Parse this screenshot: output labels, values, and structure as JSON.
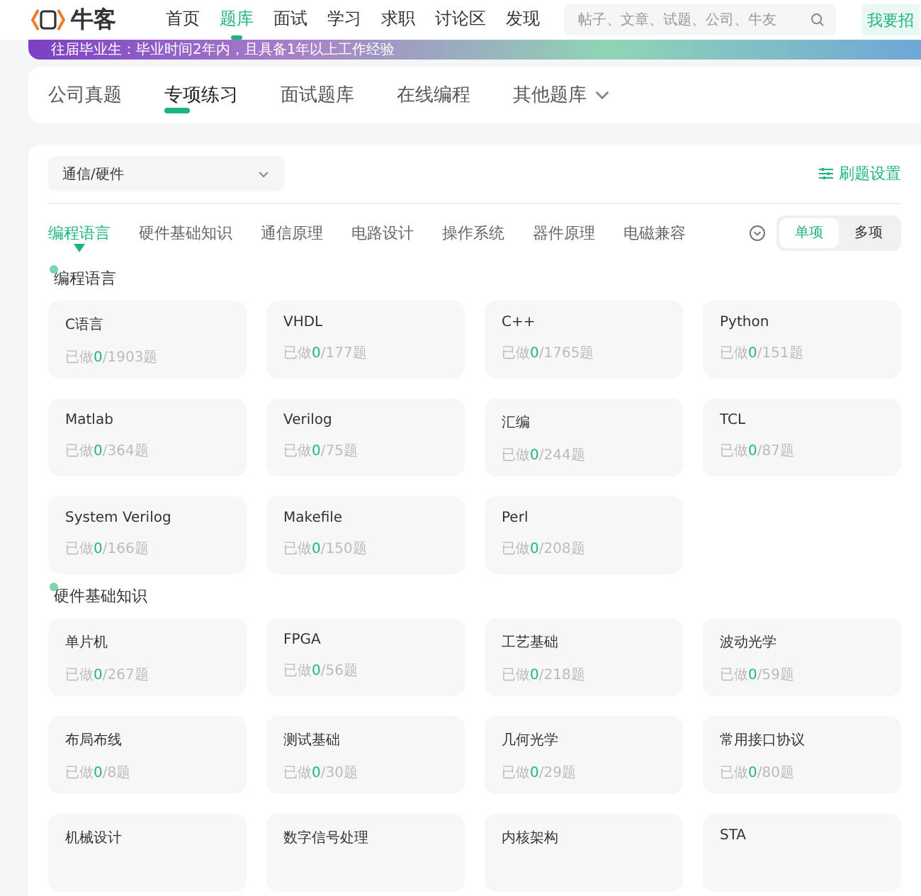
{
  "header": {
    "logo": "牛客",
    "nav": [
      {
        "label": "首页",
        "selected": false
      },
      {
        "label": "题库",
        "selected": true
      },
      {
        "label": "面试",
        "selected": false
      },
      {
        "label": "学习",
        "selected": false
      },
      {
        "label": "求职",
        "selected": false
      },
      {
        "label": "讨论区",
        "selected": false
      },
      {
        "label": "发现",
        "selected": false
      }
    ],
    "search": {
      "placeholder": "帖子、文章、试题、公司、牛友"
    },
    "cta": "我要招"
  },
  "banner": {
    "text": "往届毕业生：毕业时间2年内，且具备1年以上工作经验"
  },
  "bank_tabs": [
    {
      "label": "公司真题",
      "selected": false,
      "dropdown": false
    },
    {
      "label": "专项练习",
      "selected": true,
      "dropdown": false
    },
    {
      "label": "面试题库",
      "selected": false,
      "dropdown": false
    },
    {
      "label": "在线编程",
      "selected": false,
      "dropdown": false
    },
    {
      "label": "其他题库",
      "selected": false,
      "dropdown": true
    }
  ],
  "filter": {
    "value": "通信/硬件",
    "settings": "刷题设置"
  },
  "categories": [
    {
      "label": "编程语言",
      "selected": true
    },
    {
      "label": "硬件基础知识",
      "selected": false
    },
    {
      "label": "通信原理",
      "selected": false
    },
    {
      "label": "电路设计",
      "selected": false
    },
    {
      "label": "操作系统",
      "selected": false
    },
    {
      "label": "器件原理",
      "selected": false
    },
    {
      "label": "电磁兼容",
      "selected": false
    }
  ],
  "mode": [
    {
      "label": "单项",
      "selected": true
    },
    {
      "label": "多项",
      "selected": false
    }
  ],
  "sections": [
    {
      "title": "编程语言",
      "items": [
        {
          "name": "C语言",
          "prefix": "已做",
          "done": "0",
          "suffix": "/1903题"
        },
        {
          "name": "VHDL",
          "prefix": "已做",
          "done": "0",
          "suffix": "/177题"
        },
        {
          "name": "C++",
          "prefix": "已做",
          "done": "0",
          "suffix": "/1765题"
        },
        {
          "name": "Python",
          "prefix": "已做",
          "done": "0",
          "suffix": "/151题"
        },
        {
          "name": "Matlab",
          "prefix": "已做",
          "done": "0",
          "suffix": "/364题"
        },
        {
          "name": "Verilog",
          "prefix": "已做",
          "done": "0",
          "suffix": "/75题"
        },
        {
          "name": "汇编",
          "prefix": "已做",
          "done": "0",
          "suffix": "/244题"
        },
        {
          "name": "TCL",
          "prefix": "已做",
          "done": "0",
          "suffix": "/87题"
        },
        {
          "name": "System Verilog",
          "prefix": "已做",
          "done": "0",
          "suffix": "/166题"
        },
        {
          "name": "Makefile",
          "prefix": "已做",
          "done": "0",
          "suffix": "/150题"
        },
        {
          "name": "Perl",
          "prefix": "已做",
          "done": "0",
          "suffix": "/208题"
        }
      ]
    },
    {
      "title": "硬件基础知识",
      "items": [
        {
          "name": "单片机",
          "prefix": "已做",
          "done": "0",
          "suffix": "/267题"
        },
        {
          "name": "FPGA",
          "prefix": "已做",
          "done": "0",
          "suffix": "/56题"
        },
        {
          "name": "工艺基础",
          "prefix": "已做",
          "done": "0",
          "suffix": "/218题"
        },
        {
          "name": "波动光学",
          "prefix": "已做",
          "done": "0",
          "suffix": "/59题"
        },
        {
          "name": "布局布线",
          "prefix": "已做",
          "done": "0",
          "suffix": "/8题"
        },
        {
          "name": "测试基础",
          "prefix": "已做",
          "done": "0",
          "suffix": "/30题"
        },
        {
          "name": "几何光学",
          "prefix": "已做",
          "done": "0",
          "suffix": "/29题"
        },
        {
          "name": "常用接口协议",
          "prefix": "已做",
          "done": "0",
          "suffix": "/80题"
        },
        {
          "name": "机械设计"
        },
        {
          "name": "数字信号处理"
        },
        {
          "name": "内核架构"
        },
        {
          "name": "STA"
        }
      ]
    }
  ]
}
